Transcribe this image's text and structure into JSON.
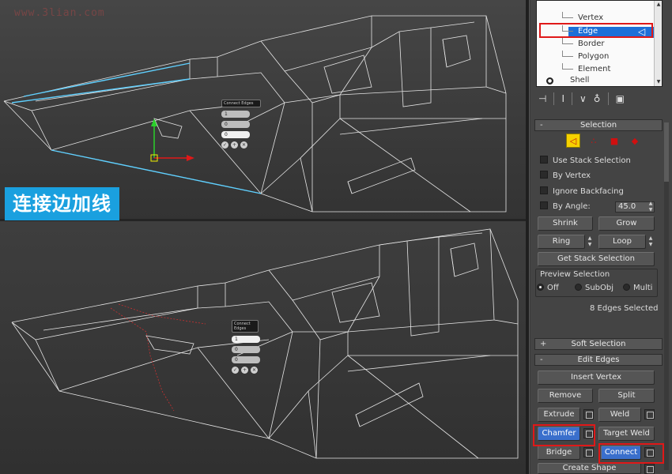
{
  "watermark": "www.3lian.com",
  "caption": "连接边加线",
  "top_caddy": {
    "title": "Connect Edges",
    "field1": "1",
    "field2": "0",
    "field3": "0"
  },
  "bottom_caddy": {
    "title": "Connect Edges",
    "field1": "1",
    "field2": "0",
    "field3": "0"
  },
  "tree": {
    "items": [
      "Vertex",
      "Edge",
      "Border",
      "Polygon",
      "Element"
    ],
    "shell": "Shell",
    "selected": "Edge"
  },
  "selection": {
    "header": "Selection",
    "use_stack": "Use Stack Selection",
    "by_vertex": "By Vertex",
    "ignore_backfacing": "Ignore Backfacing",
    "by_angle": "By Angle:",
    "by_angle_value": "45.0",
    "shrink": "Shrink",
    "grow": "Grow",
    "ring": "Ring",
    "loop": "Loop",
    "get_stack_selection": "Get Stack Selection",
    "preview_label": "Preview Selection",
    "preview_off": "Off",
    "preview_subobj": "SubObj",
    "preview_multi": "Multi",
    "status": "8 Edges Selected"
  },
  "soft_selection": {
    "header": "Soft Selection"
  },
  "edit_edges": {
    "header": "Edit Edges",
    "insert_vertex": "Insert Vertex",
    "remove": "Remove",
    "split": "Split",
    "extrude": "Extrude",
    "weld": "Weld",
    "chamfer": "Chamfer",
    "target_weld": "Target Weld",
    "bridge": "Bridge",
    "connect": "Connect",
    "create_shape": "Create Shape"
  },
  "colors": {
    "accent": "#1aa0df",
    "highlight_red": "#e01818",
    "selection_blue": "#3a6fcc",
    "wire_white": "#e6e6e6",
    "wire_selected": "#5fd0ff"
  }
}
